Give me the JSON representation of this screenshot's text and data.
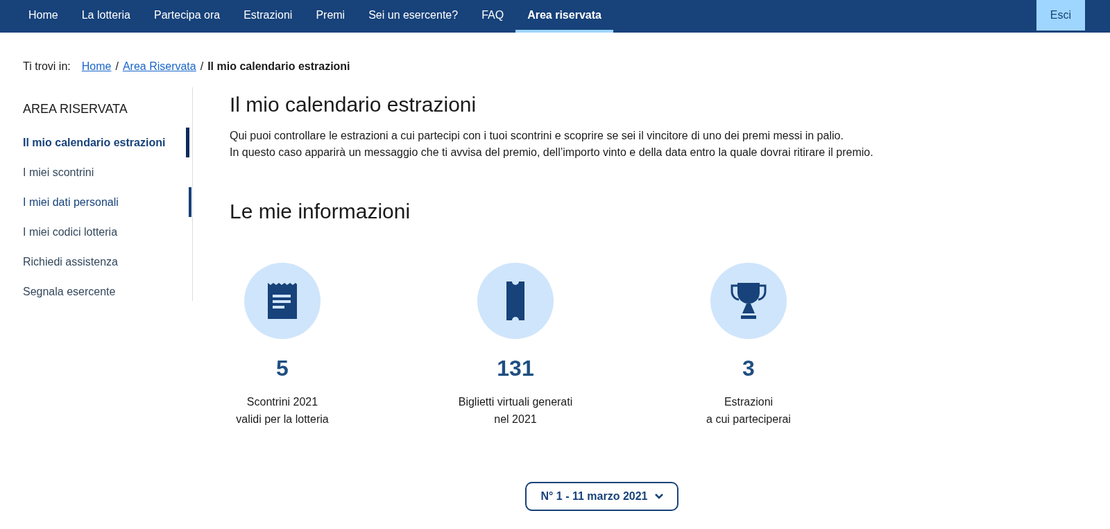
{
  "nav": {
    "items": [
      {
        "label": "Home",
        "selected": false
      },
      {
        "label": "La lotteria",
        "selected": false
      },
      {
        "label": "Partecipa ora",
        "selected": false
      },
      {
        "label": "Estrazioni",
        "selected": false
      },
      {
        "label": "Premi",
        "selected": false
      },
      {
        "label": "Sei un esercente?",
        "selected": false
      },
      {
        "label": "FAQ",
        "selected": false
      },
      {
        "label": "Area riservata",
        "selected": true
      }
    ],
    "logout": "Esci"
  },
  "breadcrumb": {
    "prefix": "Ti trovi in:",
    "links": [
      "Home",
      "Area Riservata"
    ],
    "current": "Il mio calendario estrazioni",
    "separator": "/"
  },
  "sidebar": {
    "title": "AREA RISERVATA",
    "items": [
      {
        "label": "Il mio calendario estrazioni",
        "selected": true,
        "hovered": false
      },
      {
        "label": "I miei scontrini",
        "selected": false,
        "hovered": false
      },
      {
        "label": "I miei dati personali",
        "selected": false,
        "hovered": true
      },
      {
        "label": "I miei codici lotteria",
        "selected": false,
        "hovered": false
      },
      {
        "label": "Richiedi assistenza",
        "selected": false,
        "hovered": false
      },
      {
        "label": "Segnala esercente",
        "selected": false,
        "hovered": false
      }
    ]
  },
  "main": {
    "title": "Il mio calendario estrazioni",
    "intro": [
      "Qui puoi controllare le estrazioni a cui partecipi con i tuoi scontrini e scoprire se sei il vincitore di uno dei premi messi in palio.",
      "In questo caso apparirà un messaggio che ti avvisa del premio, dell’importo vinto e della data entro la quale dovrai ritirare il premio."
    ],
    "section_title": "Le mie informazioni",
    "stats": [
      {
        "kind": "receipt",
        "value": "5",
        "caption": [
          "Scontrini 2021",
          "validi per la lotteria"
        ]
      },
      {
        "kind": "ticket",
        "value": "131",
        "caption": [
          "Biglietti virtuali generati",
          "nel 2021"
        ]
      },
      {
        "kind": "trophy",
        "value": "3",
        "caption": [
          "Estrazioni",
          "a cui parteciperai"
        ]
      }
    ],
    "draw_select": "N° 1 - 11 marzo 2021"
  }
}
